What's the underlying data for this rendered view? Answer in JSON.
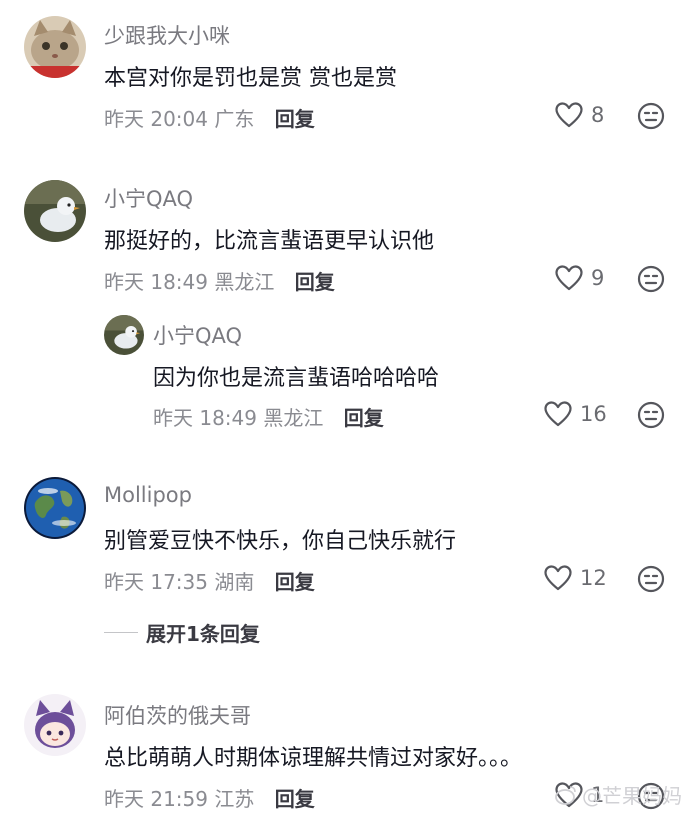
{
  "comments": [
    {
      "username": "少跟我大小咪",
      "text": "本宫对你是罚也是赏 赏也是赏",
      "time": "昨天 20:04",
      "location": "广东",
      "reply_label": "回复",
      "likes": "8"
    },
    {
      "username": "小宁QAQ",
      "text": "那挺好的，比流言蜚语更早认识他",
      "time": "昨天 18:49",
      "location": "黑龙江",
      "reply_label": "回复",
      "likes": "9"
    },
    {
      "username": "小宁QAQ",
      "text": "因为你也是流言蜚语哈哈哈哈",
      "time": "昨天 18:49",
      "location": "黑龙江",
      "reply_label": "回复",
      "likes": "16"
    },
    {
      "username": "Mollipop",
      "text": "别管爱豆快不快乐，你自己快乐就行",
      "time": "昨天 17:35",
      "location": "湖南",
      "reply_label": "回复",
      "likes": "12"
    },
    {
      "username": "阿伯茨的俄夫哥",
      "text": "总比萌萌人时期体谅理解共情过对家好。。。",
      "time": "昨天 21:59",
      "location": "江苏",
      "reply_label": "回复",
      "likes": "1"
    }
  ],
  "expand_replies_label": "展开1条回复",
  "watermark": "@芒果妈妈",
  "icons": {
    "like": "heart-outline-icon",
    "dislike": "unhappy-face-icon"
  },
  "colors": {
    "username": "#7a7a80",
    "meta": "#8a8b91",
    "text": "#161823"
  }
}
